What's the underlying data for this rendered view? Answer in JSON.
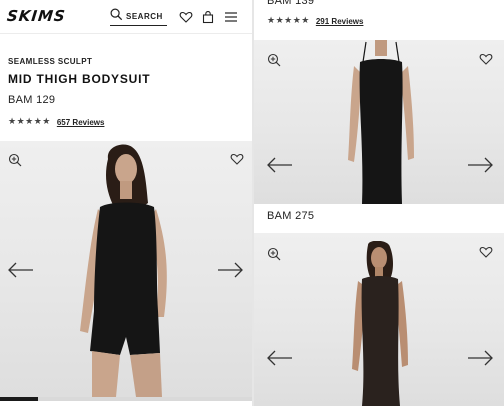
{
  "header": {
    "logo": "SKIMS",
    "search_label": "SEARCH"
  },
  "product": {
    "collection": "SEAMLESS SCULPT",
    "name": "MID THIGH BODYSUIT",
    "color": "BAM 129",
    "stars": "★★★★★",
    "reviews": "657 Reviews",
    "gallery_progress": 0.15
  },
  "right_panel": {
    "top_color": "BAM 139",
    "top_stars": "★★★★★",
    "top_reviews": "291 Reviews",
    "second_color": "BAM 275"
  },
  "colors": {
    "model_skin": "#c9a58c",
    "garment": "#151515",
    "garment_brown": "#2a221e",
    "image_bg": "#e9e9e9"
  }
}
